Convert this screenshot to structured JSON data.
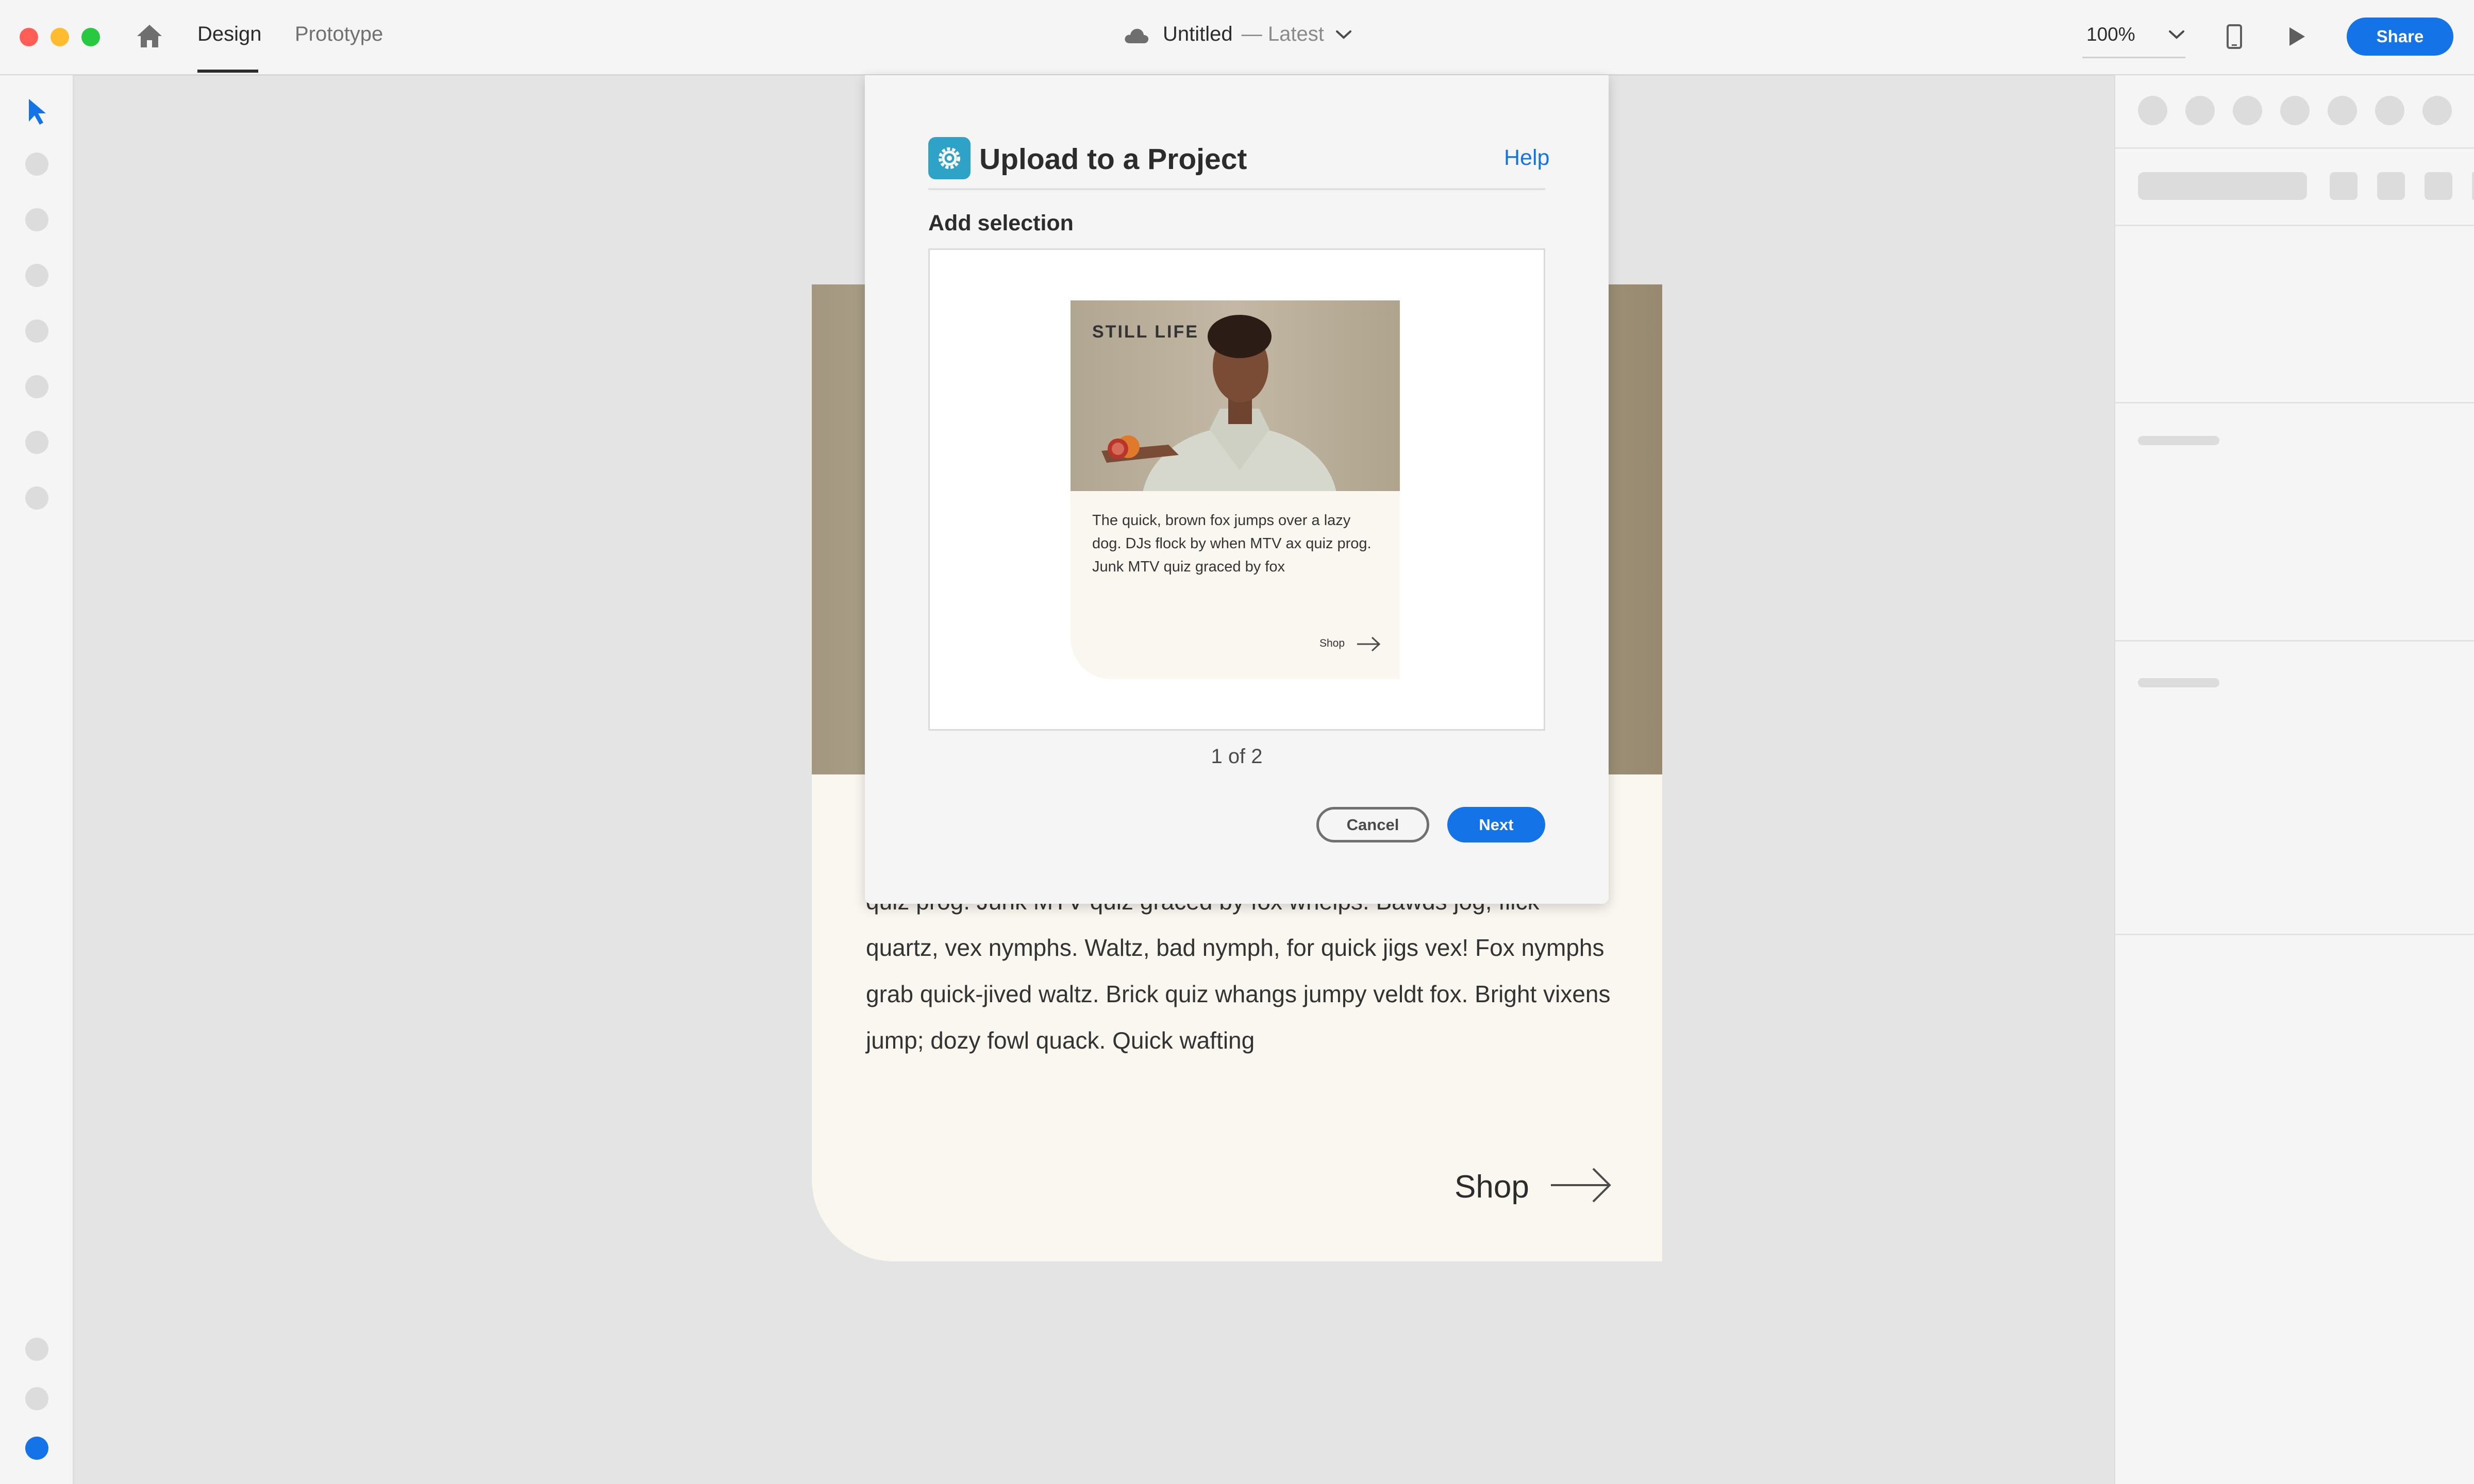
{
  "window": {
    "traffic_lights": {
      "close": "#ff5f57",
      "minimize": "#febc2e",
      "zoom": "#28c840"
    }
  },
  "topbar": {
    "tabs": [
      {
        "label": "Design",
        "active": true
      },
      {
        "label": "Prototype",
        "active": false
      }
    ],
    "doc_title": "Untitled",
    "doc_status": "— Latest",
    "zoom": "100%",
    "share_label": "Share"
  },
  "canvas": {
    "artboard_text": "quiz prog. Junk MTV quiz graced by fox whelps. Bawds jog, flick quartz, vex nymphs. Waltz, bad nymph, for quick jigs vex! Fox nymphs grab quick-jived waltz. Brick quiz whangs jumpy veldt fox. Bright vixens jump; dozy fowl quack. Quick wafting",
    "artboard_shop": "Shop"
  },
  "modal": {
    "title": "Upload to a Project",
    "help": "Help",
    "subtitle": "Add selection",
    "card": {
      "heading": "STILL LIFE",
      "body": "The quick, brown fox jumps over a lazy dog. DJs flock by when MTV ax quiz prog. Junk MTV quiz graced by fox",
      "shop": "Shop"
    },
    "pager": "1 of 2",
    "cancel_label": "Cancel",
    "next_label": "Next"
  },
  "colors": {
    "accent": "#1473e6",
    "app_icon": "#2ea3c7"
  },
  "icons": [
    "home-icon",
    "cloud-icon",
    "chevron-down-icon",
    "select-arrow-icon",
    "device-phone-icon",
    "play-icon",
    "arrow-right-icon",
    "app-gear-icon"
  ]
}
